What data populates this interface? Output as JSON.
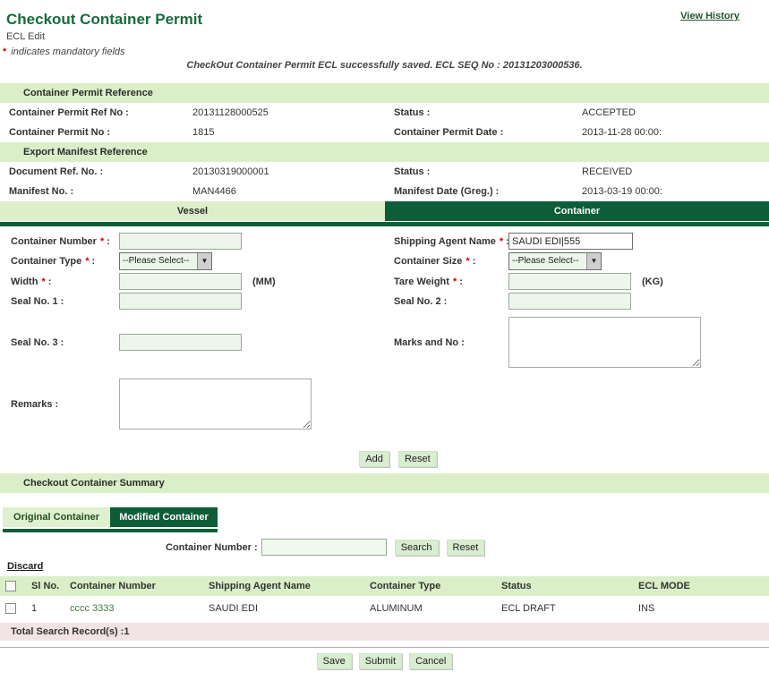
{
  "ui": {
    "colon": ":"
  },
  "header": {
    "title": "Checkout Container Permit",
    "subtitle": "ECL Edit",
    "view_history": "View History"
  },
  "notes": {
    "star": "*",
    "mandatory": " indicates mandatory fields",
    "success": "CheckOut Container Permit ECL successfully saved. ECL SEQ No : 20131203000536."
  },
  "permit_section": {
    "title": "Container Permit Reference",
    "rows": [
      {
        "l": "Container Permit Ref No :",
        "v": "20131128000525"
      },
      {
        "l": "Status :",
        "v": "ACCEPTED"
      },
      {
        "l": "Container Permit No :",
        "v": "1815"
      },
      {
        "l": "Container Permit Date :",
        "v": "2013-11-28 00:00:"
      }
    ]
  },
  "manifest_section": {
    "title": "Export Manifest Reference",
    "rows": [
      {
        "l": "Document Ref. No. :",
        "v": "20130319000001"
      },
      {
        "l": "Status :",
        "v": "RECEIVED"
      },
      {
        "l": "Manifest No. :",
        "v": "MAN4466"
      },
      {
        "l": "Manifest Date (Greg.) :",
        "v": "2013-03-19 00:00:"
      }
    ]
  },
  "main_tabs": {
    "vessel": "Vessel",
    "container": "Container"
  },
  "form": {
    "container_number": {
      "label": "Container Number",
      "star": "*",
      "value": ""
    },
    "shipping_agent": {
      "label": "Shipping Agent Name",
      "star": "*",
      "value": "SAUDI EDI|555"
    },
    "container_type": {
      "label": "Container Type",
      "star": "*",
      "value": "--Please Select--"
    },
    "container_size": {
      "label": "Container Size",
      "star": "*",
      "value": "--Please Select--"
    },
    "width": {
      "label": "Width",
      "star": "*",
      "unit": "(MM)",
      "value": ""
    },
    "tare_weight": {
      "label": "Tare Weight",
      "star": "*",
      "unit": "(KG)",
      "value": ""
    },
    "seal1": {
      "label": "Seal No. 1 :",
      "value": ""
    },
    "seal2": {
      "label": "Seal No. 2 :",
      "value": ""
    },
    "seal3": {
      "label": "Seal No. 3 :",
      "value": ""
    },
    "marks": {
      "label": "Marks and No :",
      "value": ""
    },
    "remarks": {
      "label": "Remarks :",
      "value": ""
    },
    "add": "Add",
    "reset": "Reset"
  },
  "summary": {
    "title": "Checkout Container Summary",
    "tabs": {
      "original": "Original Container",
      "modified": "Modified Container"
    },
    "search": {
      "label": "Container Number :",
      "value": "",
      "search_btn": "Search",
      "reset_btn": "Reset"
    },
    "discard": "Discard",
    "table": {
      "headers": [
        "Sl No.",
        "Container Number",
        "Shipping Agent Name",
        "Container Type",
        "Status",
        "ECL MODE"
      ],
      "rows": [
        {
          "sl": "1",
          "container_number": "cccc 3333",
          "agent": "SAUDI EDI",
          "type": "ALUMINUM",
          "status": "ECL DRAFT",
          "mode": "INS"
        }
      ],
      "total": "Total Search Record(s) :1"
    }
  },
  "footer": {
    "save": "Save",
    "submit": "Submit",
    "cancel": "Cancel"
  },
  "colors": {
    "dark_green": "#0d5e38",
    "light_green": "#daefc8",
    "title_green": "#186b3c",
    "row_link_green": "#3a7d3a",
    "total_bar_pink": "#f2e4e4"
  }
}
